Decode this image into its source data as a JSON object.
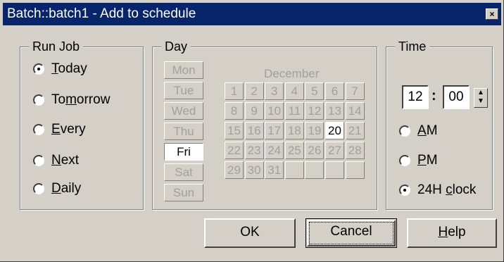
{
  "window": {
    "title": "Batch::batch1 - Add to schedule",
    "close_label": "×"
  },
  "run_job": {
    "legend": "Run Job",
    "options": [
      {
        "prefix": "",
        "mnemonic": "T",
        "rest": "oday",
        "checked": true
      },
      {
        "prefix": "To",
        "mnemonic": "m",
        "rest": "orrow",
        "checked": false
      },
      {
        "prefix": "",
        "mnemonic": "E",
        "rest": "very",
        "checked": false
      },
      {
        "prefix": "",
        "mnemonic": "N",
        "rest": "ext",
        "checked": false
      },
      {
        "prefix": "",
        "mnemonic": "D",
        "rest": "aily",
        "checked": false
      }
    ]
  },
  "day": {
    "legend": "Day",
    "days": [
      "Mon",
      "Tue",
      "Wed",
      "Thu",
      "Fri",
      "Sat",
      "Sun"
    ],
    "selected_day": "Fri",
    "month": "December",
    "calendar": [
      [
        "1",
        "2",
        "3",
        "4",
        "5",
        "6",
        "7"
      ],
      [
        "8",
        "9",
        "10",
        "11",
        "12",
        "13",
        "14"
      ],
      [
        "15",
        "16",
        "17",
        "18",
        "19",
        "20",
        "21"
      ],
      [
        "22",
        "23",
        "24",
        "25",
        "26",
        "27",
        "28"
      ],
      [
        "29",
        "30",
        "31",
        "",
        "",
        "",
        ""
      ]
    ],
    "selected_date": "20"
  },
  "time": {
    "legend": "Time",
    "hour": "12",
    "separator": ":",
    "minute": "00",
    "spin_up": "▲",
    "spin_down": "▼",
    "options": [
      {
        "prefix": "",
        "mnemonic": "A",
        "rest": "M",
        "checked": false
      },
      {
        "prefix": "",
        "mnemonic": "P",
        "rest": "M",
        "checked": false
      },
      {
        "prefix": "24H ",
        "mnemonic": "c",
        "rest": "lock",
        "checked": true
      }
    ]
  },
  "buttons": {
    "ok": "OK",
    "cancel": "Cancel",
    "help_mnemonic": "H",
    "help_rest": "elp"
  }
}
